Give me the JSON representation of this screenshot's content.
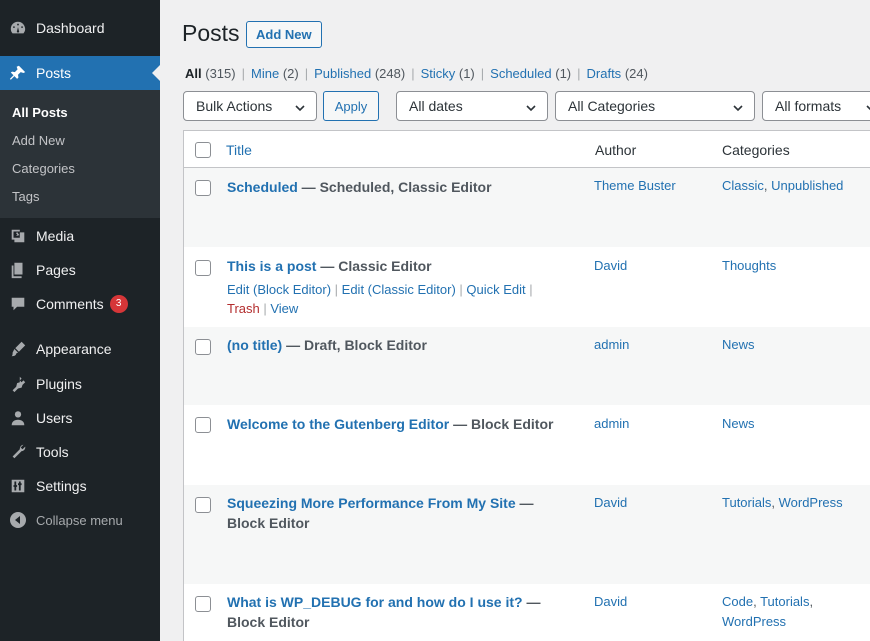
{
  "sidebar": {
    "items": [
      {
        "label": "Dashboard",
        "icon": "dashboard-icon"
      },
      {
        "label": "Posts",
        "icon": "pin-icon",
        "active": true
      },
      {
        "label": "Media",
        "icon": "media-icon"
      },
      {
        "label": "Pages",
        "icon": "pages-icon"
      },
      {
        "label": "Comments",
        "icon": "comments-icon",
        "badge": "3"
      },
      {
        "label": "Appearance",
        "icon": "appearance-icon"
      },
      {
        "label": "Plugins",
        "icon": "plugins-icon"
      },
      {
        "label": "Users",
        "icon": "users-icon"
      },
      {
        "label": "Tools",
        "icon": "tools-icon"
      },
      {
        "label": "Settings",
        "icon": "settings-icon"
      }
    ],
    "submenu": [
      "All Posts",
      "Add New",
      "Categories",
      "Tags"
    ],
    "collapse_label": "Collapse menu"
  },
  "page": {
    "title": "Posts",
    "add_new_label": "Add New"
  },
  "filters": [
    {
      "label": "All",
      "count": "(315)",
      "current": true
    },
    {
      "label": "Mine",
      "count": "(2)"
    },
    {
      "label": "Published",
      "count": "(248)"
    },
    {
      "label": "Sticky",
      "count": "(1)"
    },
    {
      "label": "Scheduled",
      "count": "(1)"
    },
    {
      "label": "Drafts",
      "count": "(24)"
    }
  ],
  "toolbar": {
    "bulk_actions": "Bulk Actions",
    "apply": "Apply",
    "dates": "All dates",
    "categories": "All Categories",
    "formats": "All formats"
  },
  "table": {
    "headers": {
      "title": "Title",
      "author": "Author",
      "categories": "Categories"
    },
    "rows": [
      {
        "title": "Scheduled",
        "state": " — Scheduled, Classic Editor",
        "author": "Theme Buster",
        "categories": [
          "Classic",
          "Unpublished"
        ]
      },
      {
        "title": "This is a post",
        "state": " — Classic Editor",
        "author": "David",
        "categories": [
          "Thoughts"
        ],
        "actions": {
          "edit_block": "Edit (Block Editor)",
          "edit_classic": "Edit (Classic Editor)",
          "quick_edit": "Quick Edit",
          "trash": "Trash",
          "view": "View"
        }
      },
      {
        "title": "(no title)",
        "state": " — Draft, Block Editor",
        "author": "admin",
        "categories": [
          "News"
        ]
      },
      {
        "title": "Welcome to the Gutenberg Editor",
        "state": " — Block Editor",
        "author": "admin",
        "categories": [
          "News"
        ]
      },
      {
        "title": "Squeezing More Performance From My Site",
        "state": " — Block Editor",
        "author": "David",
        "categories": [
          "Tutorials",
          "WordPress"
        ]
      },
      {
        "title": "What is WP_DEBUG for and how do I use it?",
        "state": " — Block Editor",
        "author": "David",
        "categories": [
          "Code",
          "Tutorials",
          "WordPress"
        ]
      }
    ]
  },
  "colors": {
    "sidebar_bg": "#1d2327",
    "accent": "#2271b1",
    "badge": "#d63638"
  }
}
